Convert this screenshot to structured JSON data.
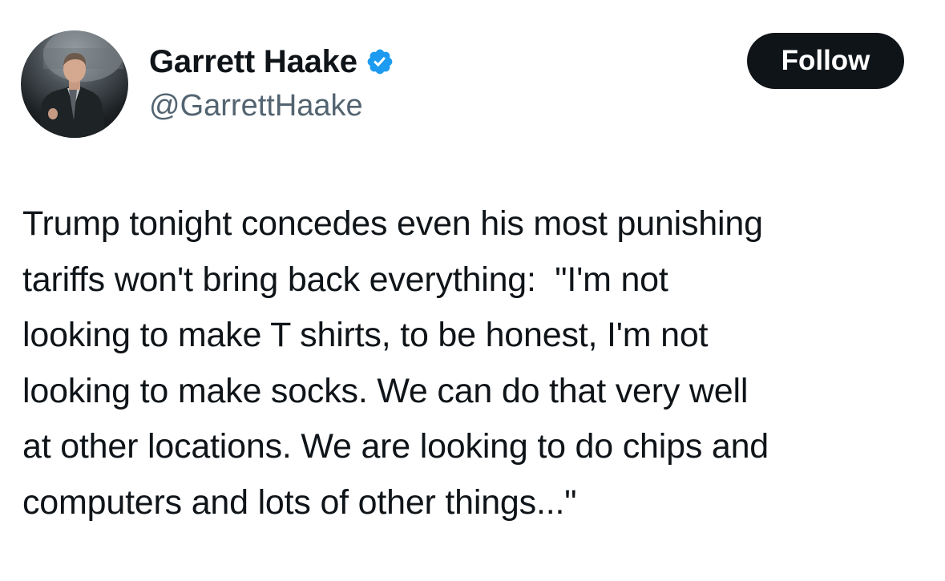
{
  "tweet": {
    "author": {
      "display_name": "Garrett Haake",
      "handle": "@GarrettHaake",
      "verified": true,
      "avatar_icon": "profile-photo"
    },
    "follow_label": "Follow",
    "text_lines": [
      "Trump tonight concedes even his most punishing",
      "tariffs won't bring back everything:  \"I'm not",
      "looking to make T shirts, to be honest, I'm not",
      "looking to make socks. We can do that very well",
      "at other locations. We are looking to do chips and",
      "computers and lots of other things...\""
    ]
  },
  "colors": {
    "text_primary": "#0f1419",
    "text_secondary": "#536471",
    "verified_blue": "#1d9bf0",
    "follow_bg": "#0f1419",
    "follow_text": "#ffffff"
  }
}
